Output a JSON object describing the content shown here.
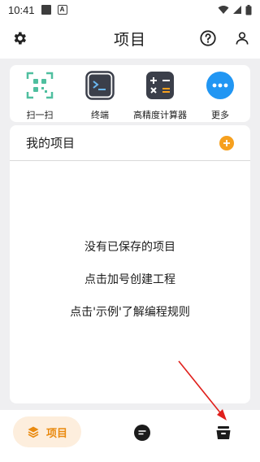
{
  "status_bar": {
    "time": "10:41",
    "notification_letter": "A"
  },
  "header": {
    "title": "项目"
  },
  "tools": [
    {
      "label": "扫一扫",
      "icon": "qr-scan-icon"
    },
    {
      "label": "终端",
      "icon": "terminal-icon"
    },
    {
      "label": "高精度计算器",
      "icon": "calculator-icon"
    },
    {
      "label": "更多",
      "icon": "more-icon"
    }
  ],
  "projects": {
    "title": "我的项目",
    "empty_lines": [
      "没有已保存的项目",
      "点击加号创建工程",
      "点击'示例'了解编程规则"
    ]
  },
  "bottom_nav": {
    "projects_label": "项目"
  },
  "colors": {
    "accent": "#f6a01e",
    "background": "#efeff1",
    "arrow": "#e0201c"
  }
}
